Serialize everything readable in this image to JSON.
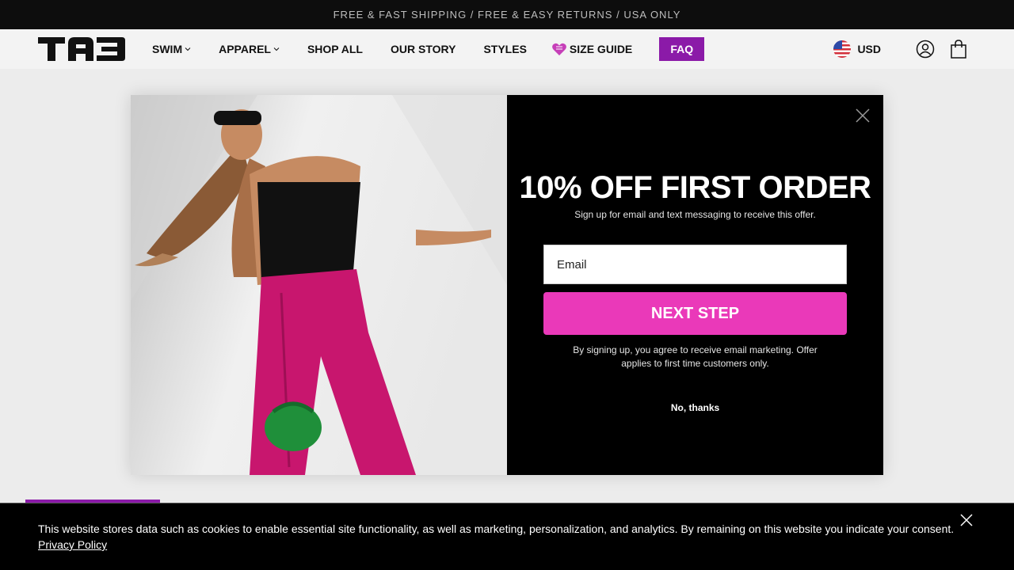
{
  "announcement": {
    "text": "FREE & FAST SHIPPING / FREE & EASY RETURNS / USA ONLY"
  },
  "header": {
    "logo_text": "TAB",
    "nav": [
      {
        "label": "SWIM",
        "has_dropdown": true
      },
      {
        "label": "APPAREL",
        "has_dropdown": true
      },
      {
        "label": "SHOP ALL",
        "has_dropdown": false
      },
      {
        "label": "OUR STORY",
        "has_dropdown": false
      },
      {
        "label": "STYLES",
        "has_dropdown": false
      },
      {
        "label": "SIZE GUIDE",
        "icon": "heart-icon"
      },
      {
        "label": "FAQ",
        "highlight": true
      }
    ],
    "currency": "USD",
    "icons": [
      "us-flag-icon",
      "account-icon",
      "cart-icon"
    ]
  },
  "modal": {
    "headline": "10% OFF FIRST ORDER",
    "subhead": "Sign up for email and text messaging to receive this offer.",
    "email_placeholder": "Email",
    "submit_label": "NEXT STEP",
    "disclaimer": "By signing up, you agree to receive email marketing. Offer applies to first time customers only.",
    "decline_label": "No, thanks"
  },
  "cookie_banner": {
    "text": "This website stores data such as cookies to enable essential site functionality, as well as marketing, personalization, and analytics. By remaining on this website you indicate your consent.",
    "link_label": "Privacy Policy"
  },
  "colors": {
    "brand_purple": "#8b1aa8",
    "cta_pink": "#ea39b9",
    "black": "#000000"
  }
}
